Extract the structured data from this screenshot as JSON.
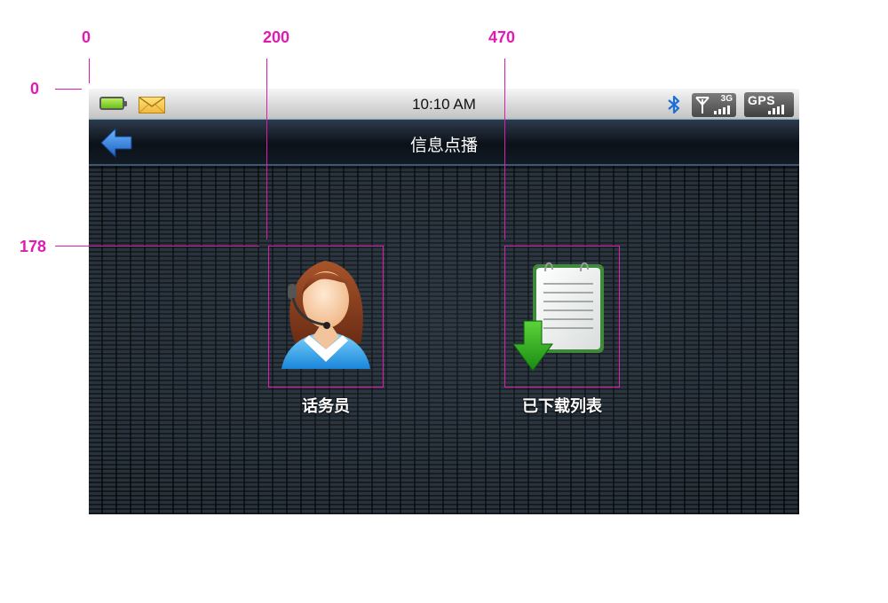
{
  "annotations": {
    "x_markers": [
      "0",
      "200",
      "470"
    ],
    "y_markers": [
      "0",
      "178"
    ]
  },
  "status_bar": {
    "time": "10:10 AM",
    "signal_label": "3G",
    "gps_label": "GPS",
    "icons": [
      "battery-icon",
      "mail-icon",
      "bluetooth-icon",
      "signal-icon",
      "gps-icon"
    ],
    "battery_color": "#8ddc2e"
  },
  "title_bar": {
    "title": "信息点播",
    "back_icon": "arrow-left-icon",
    "back_color": "#2f86e0"
  },
  "tiles": [
    {
      "label": "话务员",
      "icon": "operator-headset-icon"
    },
    {
      "label": "已下载列表",
      "icon": "download-list-icon"
    }
  ]
}
